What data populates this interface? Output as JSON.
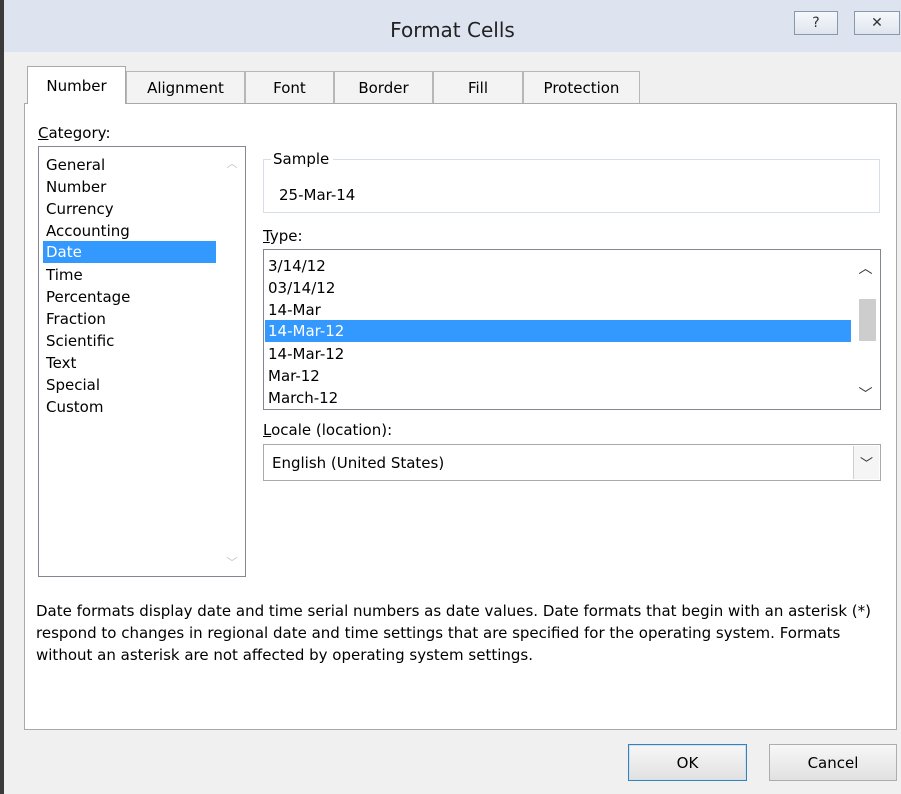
{
  "window": {
    "title": "Format Cells",
    "help_glyph": "?",
    "close_glyph": "✕"
  },
  "tabs": [
    {
      "label": "Number",
      "active": true
    },
    {
      "label": "Alignment"
    },
    {
      "label": "Font"
    },
    {
      "label": "Border"
    },
    {
      "label": "Fill"
    },
    {
      "label": "Protection"
    }
  ],
  "category": {
    "label_prefix": "C",
    "label_rest": "ategory:",
    "items": [
      "General",
      "Number",
      "Currency",
      "Accounting",
      "Date",
      "Time",
      "Percentage",
      "Fraction",
      "Scientific",
      "Text",
      "Special",
      "Custom"
    ],
    "selected": "Date"
  },
  "sample": {
    "label": "Sample",
    "value": "25-Mar-14"
  },
  "type": {
    "label_prefix": "T",
    "label_rest": "ype:",
    "items": [
      "3/14/12",
      "03/14/12",
      "14-Mar",
      "14-Mar-12",
      "14-Mar-12",
      "Mar-12",
      "March-12"
    ],
    "selected_index": 3
  },
  "locale": {
    "label_prefix": "L",
    "label_rest": "ocale (location):",
    "value": "English (United States)"
  },
  "description": "Date formats display date and time serial numbers as date values.  Date formats that begin with an asterisk (*) respond to changes in regional date and time settings that are specified for the operating system. Formats without an asterisk are not affected by operating system settings.",
  "buttons": {
    "ok": "OK",
    "cancel": "Cancel"
  },
  "colors": {
    "selection": "#3399ff",
    "titlebar": "#dde4ef"
  },
  "icons": {
    "scroll_up": "chevron-up-icon",
    "scroll_down": "chevron-down-icon"
  }
}
